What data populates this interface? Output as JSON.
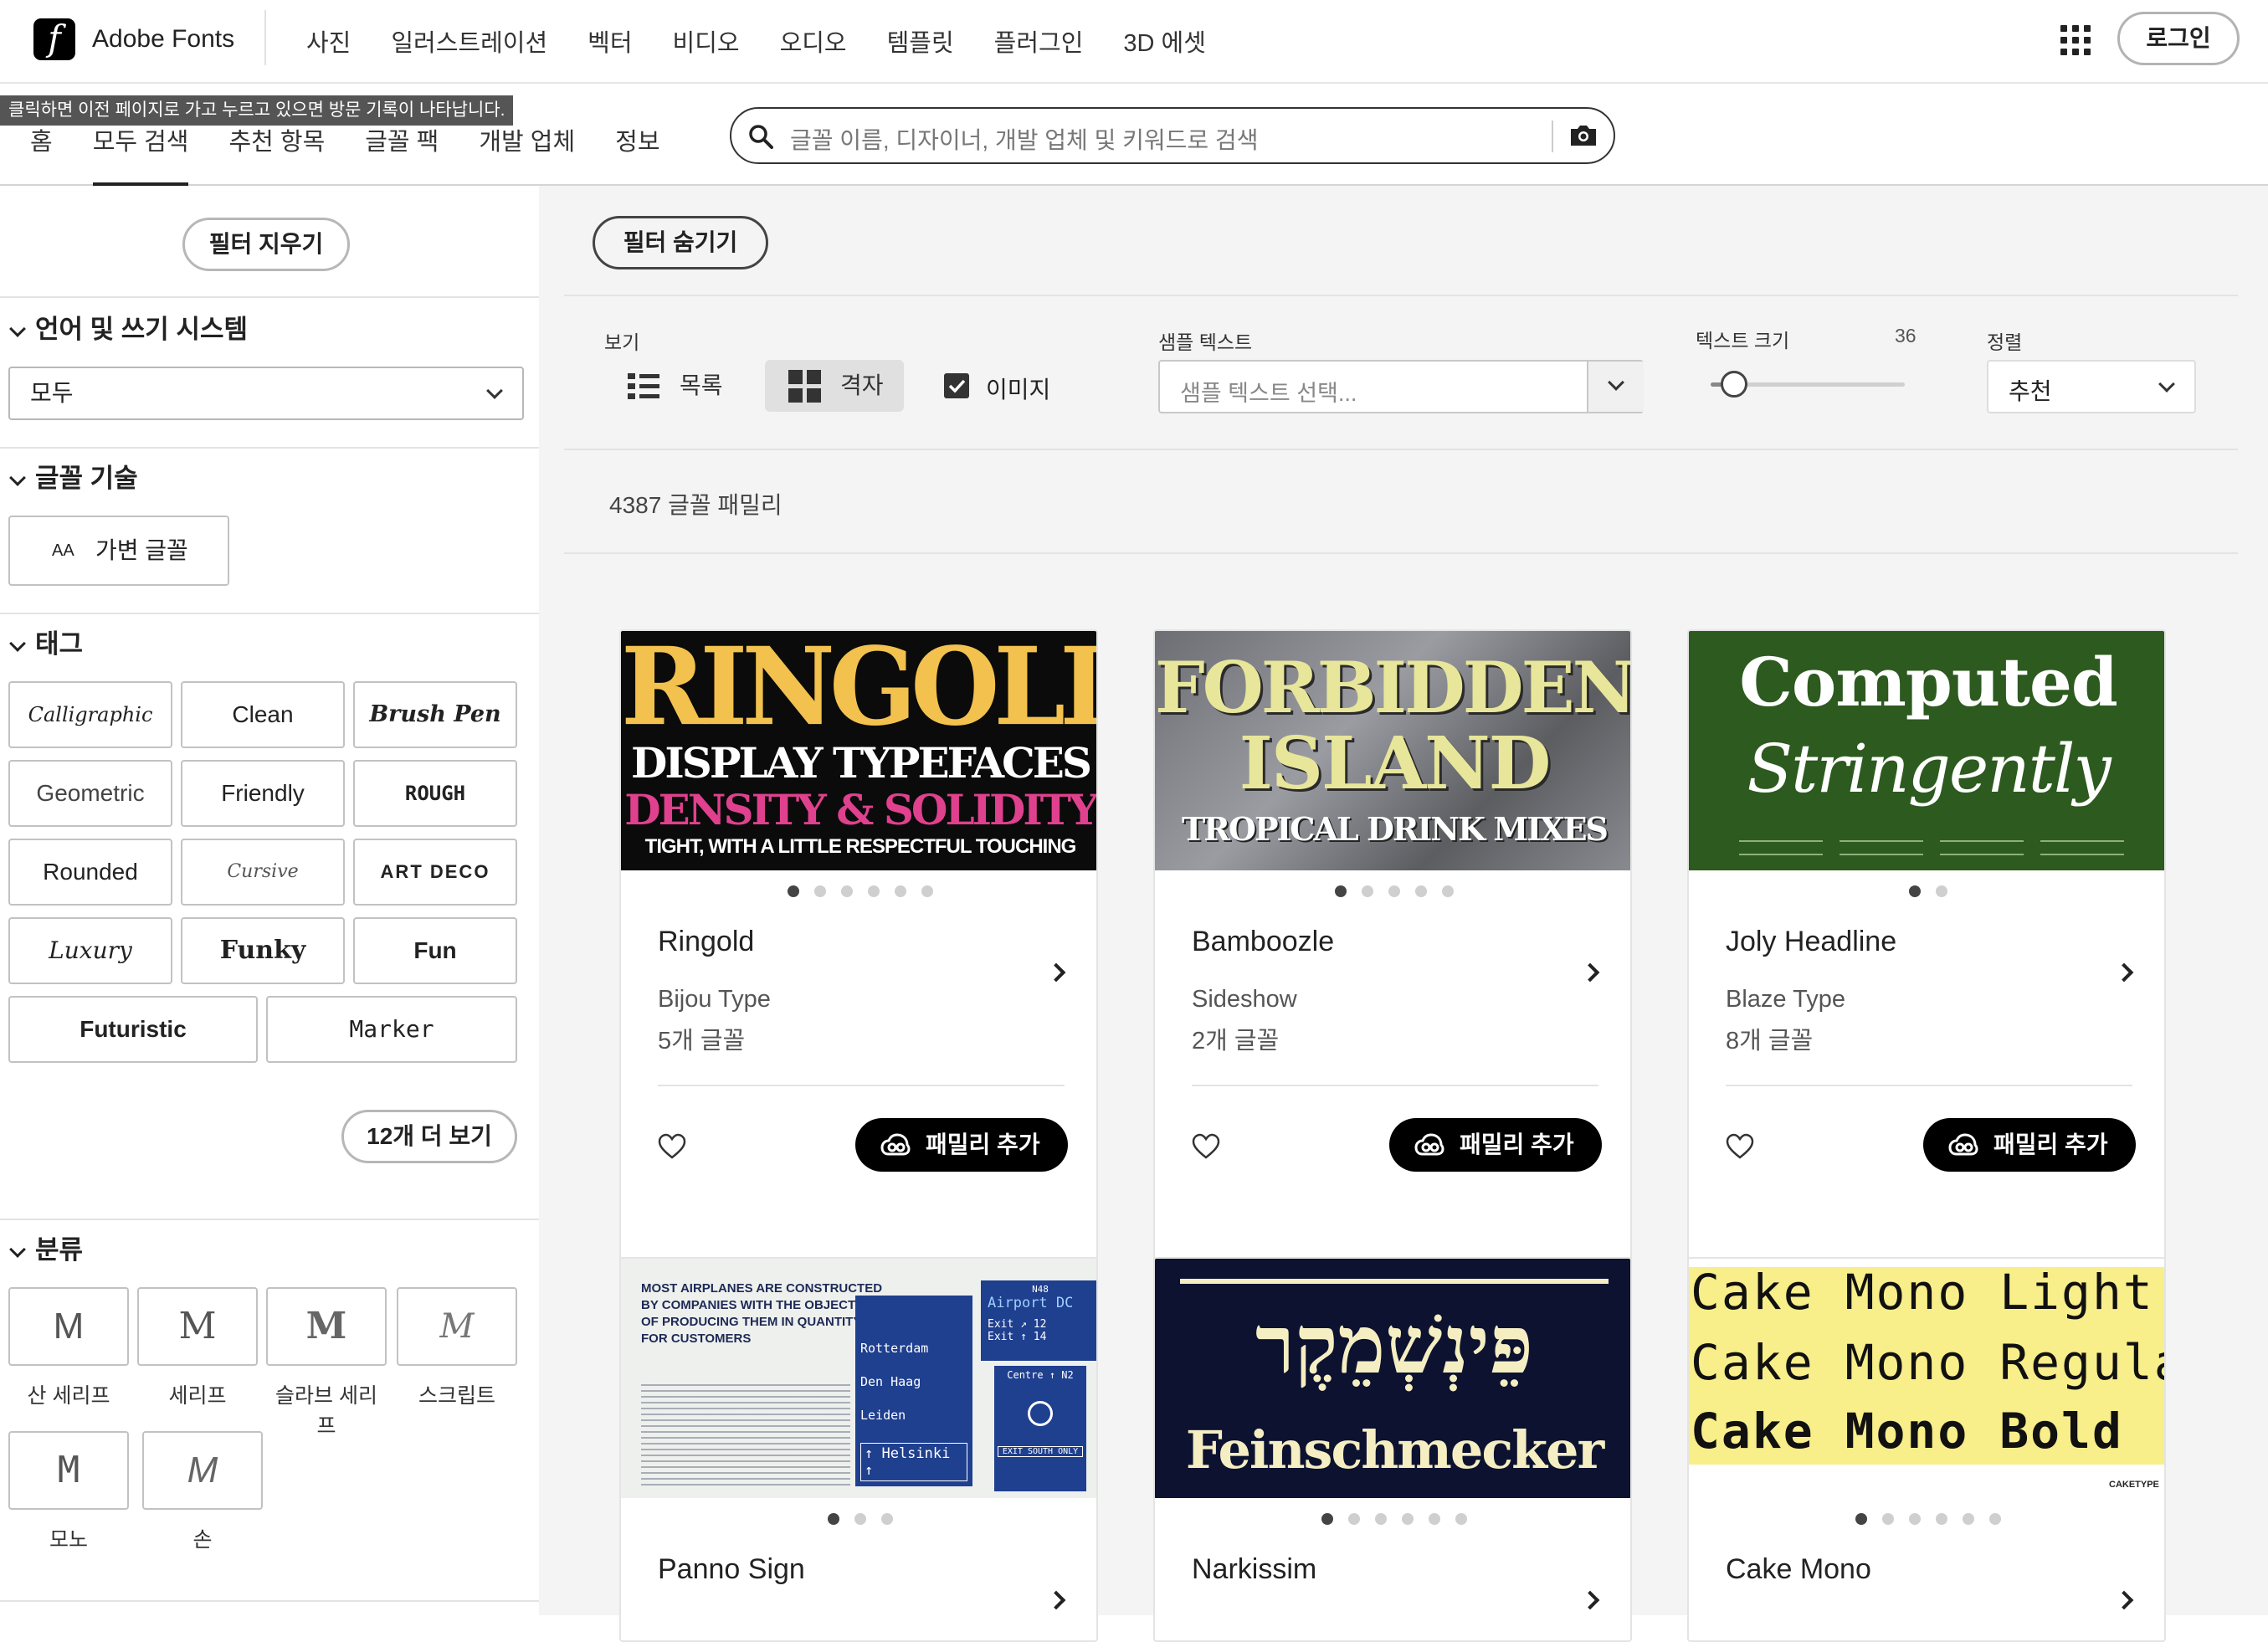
{
  "header": {
    "brand": "Adobe Fonts",
    "logo_letter": "f",
    "nav": [
      "사진",
      "일러스트레이션",
      "벡터",
      "비디오",
      "오디오",
      "템플릿",
      "플러그인",
      "3D 에셋"
    ],
    "login": "로그인"
  },
  "tooltip": "클릭하면 이전 페이지로 가고 누르고 있으면 방문 기록이 나타납니다.",
  "subnav": {
    "tabs": [
      "홈",
      "모두 검색",
      "추천 항목",
      "글꼴 팩",
      "개발 업체",
      "정보"
    ],
    "active": "모두 검색",
    "search_placeholder": "글꼴 이름, 디자이너, 개발 업체 및 키워드로 검색"
  },
  "sidebar": {
    "clear_filters": "필터 지우기",
    "language_title": "언어 및 쓰기 시스템",
    "language_value": "모두",
    "tech_title": "글꼴 기술",
    "variable": "가변 글꼴",
    "variable_icon": "AA",
    "tags_title": "태그",
    "tags": [
      "Calligraphic",
      "Clean",
      "Brush Pen",
      "Geometric",
      "Friendly",
      "ROUGH",
      "Rounded",
      "Cursive",
      "ART DECO",
      "Luxury",
      "Funky",
      "Fun",
      "Futuristic",
      "Marker"
    ],
    "more": "12개 더 보기",
    "classification_title": "분류",
    "classes": [
      {
        "glyph": "M",
        "label": "산 세리프"
      },
      {
        "glyph": "M",
        "label": "세리프"
      },
      {
        "glyph": "M",
        "label": "슬라브 세리프"
      },
      {
        "glyph": "M",
        "label": "스크립트"
      },
      {
        "glyph": "M",
        "label": "모노"
      },
      {
        "glyph": "M",
        "label": "손"
      }
    ]
  },
  "toolbar": {
    "hide_filters": "필터 숨기기",
    "view_label": "보기",
    "list": "목록",
    "grid": "격자",
    "images": "이미지",
    "sample_label": "샘플 텍스트",
    "sample_placeholder": "샘플 텍스트 선택...",
    "size_label": "텍스트 크기",
    "size_value": "36",
    "size_slider_fraction": 0.12,
    "sort_label": "정렬",
    "sort_value": "추천"
  },
  "results_count": "4387 글꼴 패밀리",
  "add_family": "패밀리 추가",
  "cards": [
    {
      "name": "Ringold",
      "foundry": "Bijou Type",
      "count": "5개 글꼴",
      "dots": 6,
      "img": {
        "l1": "RINGOLD",
        "l2": "DISPLAY TYPEFACES",
        "l3": "DENSITY & SOLIDITY",
        "l4": "TIGHT, WITH A LITTLE RESPECTFUL TOUCHING"
      }
    },
    {
      "name": "Bamboozle",
      "foundry": "Sideshow",
      "count": "2개 글꼴",
      "dots": 5,
      "img": {
        "l1": "FORBIDDEN",
        "l2": "ISLAND",
        "l3": "TROPICAL DRINK MIXES"
      }
    },
    {
      "name": "Joly Headline",
      "foundry": "Blaze Type",
      "count": "8개 글꼴",
      "dots": 2,
      "img": {
        "l1": "Computed",
        "l2": "Stringently"
      }
    },
    {
      "name": "Panno Sign",
      "dots": 3,
      "img": {
        "l1": "MOST AIRPLANES ARE CONSTRUCTED",
        "l2": "BY COMPANIES WITH THE OBJECTIVE",
        "l3": "OF PRODUCING THEM IN QUANTITY*",
        "l4": "FOR CUSTOMERS",
        "s1": "Rotterdam",
        "s2": "Den Haag",
        "s3": "Leiden",
        "s4": "↑ Helsinki ↑",
        "s5": "Airport DC",
        "s6": "Exit ↗ 12",
        "s7": "Exit ↑ 14",
        "s8": "Centre ↑ N2",
        "s9": "EXIT SOUTH ONLY",
        "s10": "N48"
      }
    },
    {
      "name": "Narkissim",
      "dots": 6,
      "img": {
        "l1": "פֵּינְשְׁמֵקֶר",
        "l2": "Feinschmecker"
      }
    },
    {
      "name": "Cake Mono",
      "dots": 6,
      "img": {
        "l1": "Cake Mono Light",
        "l2": "Cake Mono Regular",
        "l3": "Cake Mono Bold",
        "l4": "CAKETYPE"
      }
    }
  ]
}
